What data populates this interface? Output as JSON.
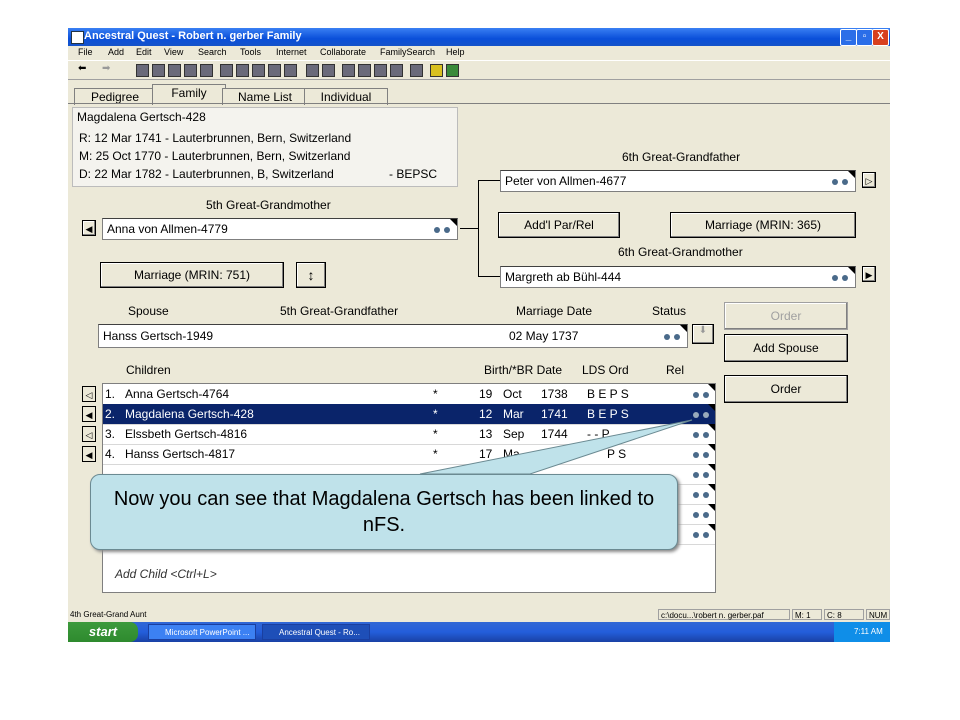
{
  "window": {
    "title": "Ancestral Quest - Robert n. gerber Family",
    "controls": [
      "_",
      "▫",
      "X"
    ]
  },
  "menu": [
    "File",
    "Add",
    "Edit",
    "View",
    "Search",
    "Tools",
    "Internet",
    "Collaborate",
    "FamilySearch",
    "Help"
  ],
  "tabs": [
    "Pedigree",
    "Family",
    "Name List",
    "Individual"
  ],
  "individual": {
    "name": "Magdalena Gertsch-428",
    "events": [
      "R: 12 Mar 1741 - Lauterbrunnen, Bern, Switzerland",
      "M: 25 Oct 1770 - Lauterbrunnen, Bern, Switzerland",
      "D: 22 Mar 1782 - Lauterbrunnen, B, Switzerland"
    ],
    "ordinances": "- BEPSC"
  },
  "mother": {
    "relation": "5th Great-Grandmother",
    "name": "Anna von Allmen-4779",
    "marriage_button": "Marriage (MRIN: 751)"
  },
  "parents_of_mother": {
    "father_relation": "6th Great-Grandfather",
    "father_name": "Peter von Allmen-4677",
    "addl_button": "Add'l Par/Rel",
    "marriage_button": "Marriage (MRIN: 365)",
    "mother_relation": "6th Great-Grandmother",
    "mother_name": "Margreth ab Bühl-444"
  },
  "spouse_header": {
    "spouse": "Spouse",
    "relation": "5th Great-Grandfather",
    "marriage_date": "Marriage Date",
    "status": "Status"
  },
  "spouse": {
    "name": "Hanss Gertsch-1949",
    "marriage_date": "02  May  1737"
  },
  "side_buttons": {
    "order_top": "Order",
    "add_spouse": "Add Spouse",
    "order": "Order"
  },
  "children_header": {
    "children": "Children",
    "birth": "Birth/*BR Date",
    "lds": "LDS Ord",
    "rel": "Rel"
  },
  "children": [
    {
      "num": "1.",
      "name": "Anna Gertsch-4764",
      "star": "*",
      "day": "19",
      "mon": "Oct",
      "year": "1738",
      "lds": "B E P S"
    },
    {
      "num": "2.",
      "name": "Magdalena Gertsch-428",
      "star": "*",
      "day": "12",
      "mon": "Mar",
      "year": "1741",
      "lds": "B E P S"
    },
    {
      "num": "3.",
      "name": "Elssbeth Gertsch-4816",
      "star": "*",
      "day": "13",
      "mon": "Sep",
      "year": "1744",
      "lds": "-  -  P"
    },
    {
      "num": "4.",
      "name": "Hanss Gertsch-4817",
      "star": "*",
      "day": "17",
      "mon": "Ma",
      "year": "",
      "lds": "P S"
    }
  ],
  "add_child": "Add Child <Ctrl+L>",
  "status_bar": {
    "left": "4th Great-Grand Aunt",
    "path": "c:\\docu...\\robert n. gerber.paf",
    "m": "M: 1",
    "c": "C: 8",
    "num": "NUM"
  },
  "taskbar": {
    "start": "start",
    "task1": "Microsoft PowerPoint ...",
    "task2": "Ancestral Quest - Ro...",
    "time": "7:11 AM"
  },
  "callout": "Now you can see that Magdalena Gertsch has been linked to nFS.",
  "colors": {
    "selection": "#0a246a",
    "titlebar": "#0a4fd9",
    "callout_bg": "#bfe2ea"
  }
}
